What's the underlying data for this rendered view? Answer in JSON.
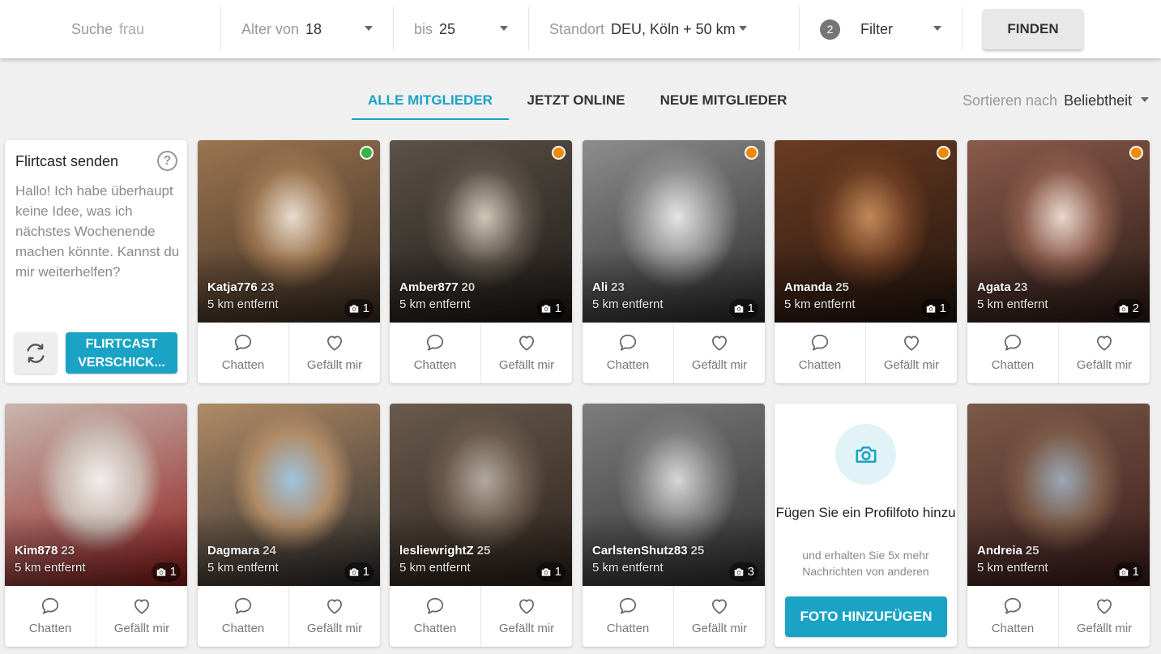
{
  "filter_bar": {
    "search_label": "Suche",
    "search_value": "frau",
    "age_from_label": "Alter von",
    "age_from_value": "18",
    "age_to_label": "bis",
    "age_to_value": "25",
    "location_label": "Standort",
    "location_value": "DEU, Köln + 50 km",
    "filter_count": "2",
    "filter_label": "Filter",
    "find_button": "FINDEN"
  },
  "tabs": [
    {
      "label": "ALLE MITGLIEDER",
      "active": true
    },
    {
      "label": "JETZT ONLINE",
      "active": false
    },
    {
      "label": "NEUE MITGLIEDER",
      "active": false
    }
  ],
  "sort": {
    "label": "Sortieren nach",
    "value": "Beliebtheit"
  },
  "flirtcast": {
    "title": "Flirtcast senden",
    "help": "?",
    "message": "Hallo! Ich habe überhaupt keine Idee, was ich nächstes Wochenende machen könnte. Kannst du mir weiterhelfen?",
    "send_line1": "FLIRTCAST",
    "send_line2": "VERSCHICK..."
  },
  "actions": {
    "chat": "Chatten",
    "like": "Gefällt mir"
  },
  "profiles": [
    {
      "name": "Katja776",
      "age": "23",
      "distance": "5 km entfernt",
      "photos": "1",
      "status": "online",
      "colors": [
        "#e8dccd",
        "#9b7550",
        "#3a2c22"
      ]
    },
    {
      "name": "Amber877",
      "age": "20",
      "distance": "5 km entfernt",
      "photos": "1",
      "status": "away",
      "colors": [
        "#cfc7b8",
        "#5b5249",
        "#1d1916"
      ]
    },
    {
      "name": "Ali",
      "age": "23",
      "distance": "5 km entfernt",
      "photos": "1",
      "status": "away",
      "colors": [
        "#e4e4e4",
        "#8d8d8d",
        "#2b2b2b"
      ]
    },
    {
      "name": "Amanda",
      "age": "25",
      "distance": "5 km entfernt",
      "photos": "1",
      "status": "away",
      "colors": [
        "#c28758",
        "#6a3c22",
        "#22140e"
      ]
    },
    {
      "name": "Agata",
      "age": "23",
      "distance": "5 km entfernt",
      "photos": "2",
      "status": "away",
      "colors": [
        "#ead7cc",
        "#8a5b4b",
        "#2a1a16"
      ]
    },
    {
      "name": "Kim878",
      "age": "23",
      "distance": "5 km entfernt",
      "photos": "1",
      "status": "",
      "colors": [
        "#f2eeec",
        "#c7b7ae",
        "#8e1b1b"
      ]
    },
    {
      "name": "Dagmara",
      "age": "24",
      "distance": "5 km entfernt",
      "photos": "1",
      "status": "",
      "colors": [
        "#9fc4df",
        "#b08b66",
        "#2b2a2b"
      ]
    },
    {
      "name": "lesliewrightZ",
      "age": "25",
      "distance": "5 km entfernt",
      "photos": "1",
      "status": "",
      "colors": [
        "#b2a89c",
        "#6a5a4d",
        "#2a211b"
      ]
    },
    {
      "name": "CarlstenShutz83",
      "age": "25",
      "distance": "5 km entfernt",
      "photos": "3",
      "status": "",
      "colors": [
        "#d6d6d6",
        "#7d7d7d",
        "#2f2f2f"
      ]
    },
    {
      "name": "Andreia",
      "age": "25",
      "distance": "5 km entfernt",
      "photos": "1",
      "status": "",
      "colors": [
        "#9aa7b6",
        "#7b5a48",
        "#3b1c1c"
      ]
    }
  ],
  "add_photo": {
    "title": "Fügen Sie ein Profilfoto hinzu",
    "subtitle": "und erhalten Sie 5x mehr Nachrichten von anderen",
    "button": "FOTO HINZUFÜGEN"
  },
  "colors": {
    "accent": "#1aa3c4",
    "online": "#3cb24b",
    "away": "#f08a00"
  }
}
